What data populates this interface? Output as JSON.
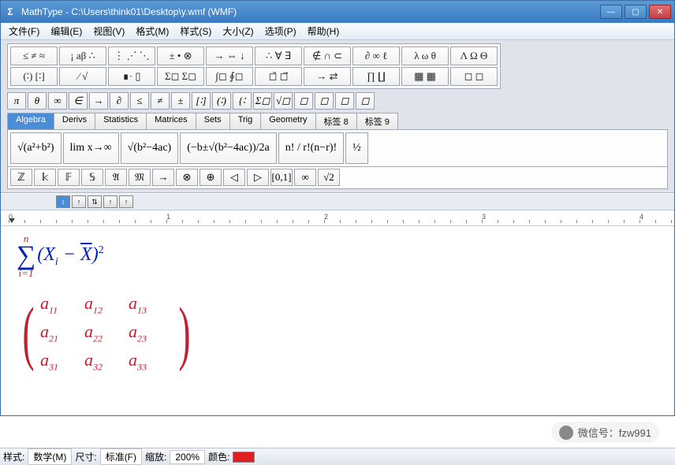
{
  "window": {
    "app_icon": "Σ",
    "title": "MathType - C:\\Users\\think01\\Desktop\\y.wmf (WMF)"
  },
  "menu": [
    "文件(F)",
    "编辑(E)",
    "视图(V)",
    "格式(M)",
    "样式(S)",
    "大小(Z)",
    "选项(P)",
    "帮助(H)"
  ],
  "palette_rows": [
    [
      "≤ ≠ ≈",
      "¡ aβ ∴",
      "⋮ ⋰ ⋱",
      "± • ⊗",
      "→ ⇔ ↓",
      "∴ ∀ ∃",
      "∉ ∩ ⊂",
      "∂ ∞ ℓ",
      "λ ω θ",
      "Λ Ω Θ"
    ],
    [
      "(∶) [∶]",
      "⁄ √",
      "∎· ▯",
      "Σ◻ Σ◻",
      "∫◻ ∮◻",
      "◻̄ ◻⃗",
      "→ ⇄",
      "∏ ∐",
      "▦ ▦",
      "◻ ◻"
    ]
  ],
  "small_symbols": [
    "π",
    "θ",
    "∞",
    "∈",
    "→",
    "∂",
    "≤",
    "≠",
    "±",
    "[∶]",
    "(∶)",
    "{∶",
    "Σ◻",
    "√◻",
    "◻",
    "◻",
    "◻",
    "◻"
  ],
  "tabs": [
    "Algebra",
    "Derivs",
    "Statistics",
    "Matrices",
    "Sets",
    "Trig",
    "Geometry",
    "标签 8",
    "标签 9"
  ],
  "active_tab": 0,
  "templates": [
    "√(a²+b²)",
    "lim x→∞",
    "√(b²−4ac)",
    "(−b±√(b²−4ac))/2a",
    "n! / r!(n−r)!",
    "½"
  ],
  "sym_row": [
    "ℤ",
    "𝕜",
    "𝔽",
    "𝕊",
    "𝔄",
    "𝔐",
    "→",
    "⊗",
    "⊕",
    "◁",
    "▷",
    "[0,1]",
    "∞",
    "√2"
  ],
  "ruler_marks": [
    "0",
    "1",
    "2",
    "3",
    "4"
  ],
  "equation1": {
    "sigma_top": "n",
    "sigma_bottom": "i=1",
    "body": "(Xᵢ − X̄)²"
  },
  "matrix": {
    "rows": 3,
    "cols": 3,
    "cells": [
      "a₁₁",
      "a₁₂",
      "a₁₃",
      "a₂₁",
      "a₂₂",
      "a₂₃",
      "a₃₁",
      "a₃₂",
      "a₃₃"
    ]
  },
  "watermark": "微信号：fzw991",
  "status": {
    "style_label": "样式:",
    "style_value": "数学(M)",
    "size_label": "尺寸:",
    "size_value": "标准(F)",
    "zoom_label": "缩放:",
    "zoom_value": "200%",
    "color_label": "颜色:"
  }
}
